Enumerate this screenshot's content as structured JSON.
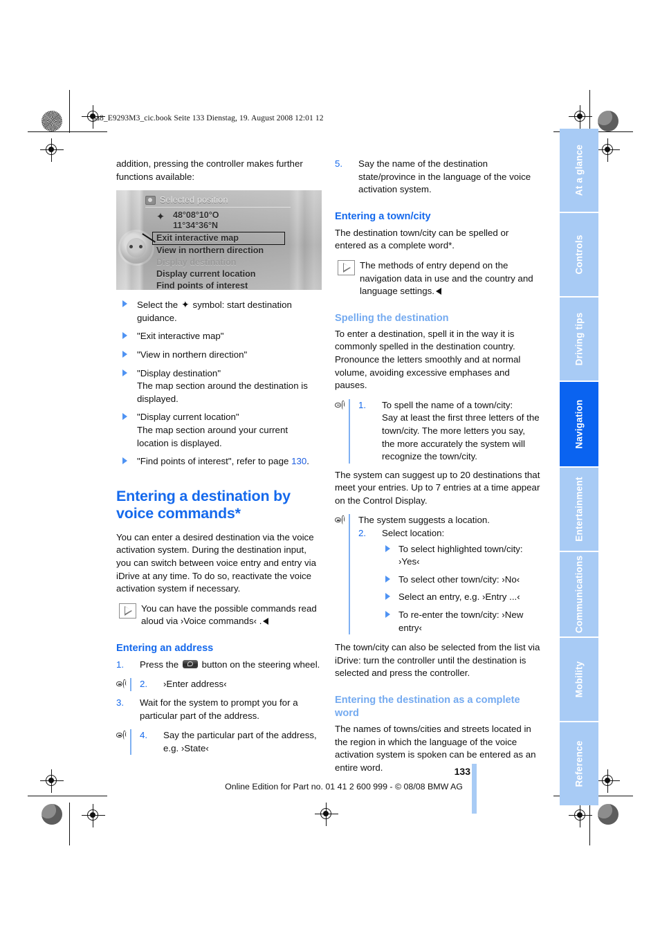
{
  "header": {
    "slug": "ba8_E9293M3_cic.book  Seite 133  Dienstag, 19. August 2008  12:01 12"
  },
  "sidebar": {
    "tabs": [
      {
        "label": "At a glance",
        "active": false
      },
      {
        "label": "Controls",
        "active": false
      },
      {
        "label": "Driving tips",
        "active": false
      },
      {
        "label": "Navigation",
        "active": true
      },
      {
        "label": "Entertainment",
        "active": false
      },
      {
        "label": "Communications",
        "active": false
      },
      {
        "label": "Mobility",
        "active": false
      },
      {
        "label": "Reference",
        "active": false
      }
    ],
    "colors": {
      "inactive": "#a8cbf5",
      "active": "#0a63f0",
      "label": "#ffffff"
    }
  },
  "colors": {
    "heading_blue": "#1569ec",
    "subheading_blue": "#74aaf0",
    "bullet_blue": "#4f93f3",
    "link_blue": "#1b5ce0",
    "rule_blue": "#7fb0f2"
  },
  "left_column": {
    "intro": "addition, pressing the controller makes further functions available:",
    "nav_display": {
      "title": "Selected position",
      "coordinate_lines": [
        "48°08°10°O",
        "11°34°36°N"
      ],
      "menu_items": [
        {
          "text": "Exit interactive map",
          "state": "highlighted"
        },
        {
          "text": "View in northern direction",
          "state": "normal"
        },
        {
          "text": "Display destination",
          "state": "dimmed"
        },
        {
          "text": "Display current location",
          "state": "normal"
        },
        {
          "text": "Find points of interest",
          "state": "normal"
        }
      ]
    },
    "bullets": [
      {
        "lead": "Select the",
        "icon": "destination-flag-symbol",
        "rest": "symbol: start destination guidance."
      },
      {
        "text": "\"Exit interactive map\""
      },
      {
        "text": "\"View in northern direction\""
      },
      {
        "text": "\"Display destination\"",
        "detail": "The map section around the destination is displayed."
      },
      {
        "text": "\"Display current location\"",
        "detail": "The map section around your current location is displayed."
      },
      {
        "text": "\"Find points of interest\", refer to page",
        "page_ref": "130",
        "tail": "."
      }
    ],
    "section_heading": "Entering a destination by voice commands*",
    "section_body": "You can enter a desired destination via the voice activation system. During the destination input, you can switch between voice entry and entry via iDrive at any time. To do so, reactivate the voice activation system if necessary.",
    "note": {
      "text": "You can have the possible commands read aloud via ›Voice commands‹ ."
    },
    "subheading": "Entering an address",
    "steps": [
      {
        "num": "1.",
        "voice": false,
        "pre": "Press the",
        "button_icon": "voice-button",
        "post": "button on the steering wheel."
      },
      {
        "num": "2.",
        "voice": true,
        "text": "›Enter address‹"
      },
      {
        "num": "3.",
        "voice": false,
        "text": "Wait for the system to prompt you for a particular part of the address."
      },
      {
        "num": "4.",
        "voice": true,
        "text": "Say the particular part of the address, e.g. ›State‹"
      }
    ]
  },
  "right_column": {
    "step5": {
      "num": "5.",
      "text": "Say the name of the destination state/province in the language of the voice activation system."
    },
    "heading_town": "Entering a town/city",
    "town_body": "The destination town/city can be spelled or entered as a complete word*.",
    "town_note": "The methods of entry depend on the navigation data in use and the country and language settings.",
    "heading_spelling": "Spelling the destination",
    "spelling_body": "To enter a destination, spell it in the way it is commonly spelled in the destination country. Pronounce the letters smoothly and at normal volume, avoiding excessive emphases and pauses.",
    "spell_step": {
      "num": "1.",
      "line1": "To spell the name of a town/city:",
      "line2": "Say at least the first three letters of the town/city. The more letters you say, the more accurately the system will recognize the town/city."
    },
    "suggest_body": "The system can suggest up to 20 destinations that meet your entries. Up to 7 entries at a time appear on the Control Display.",
    "suggest_voice": "The system suggests a location.",
    "select_step": {
      "num": "2.",
      "text": "Select location:"
    },
    "select_bullets": [
      "To select highlighted town/city: ›Yes‹",
      "To select other town/city: ›No‹",
      "Select an entry, e.g. ›Entry  ...‹",
      "To re-enter the town/city: ›New entry‹"
    ],
    "idrive_body": "The town/city can also be selected from the list via iDrive: turn the controller until the destination is selected and press the controller.",
    "heading_complete": "Entering the destination as a complete word",
    "complete_body": "The names of towns/cities and streets located in the region in which the language of the voice activation system is spoken can be entered as an entire word."
  },
  "footer": {
    "page_number": "133",
    "copyright": "Online Edition for Part no. 01 41 2 600 999 - © 08/08 BMW AG"
  }
}
